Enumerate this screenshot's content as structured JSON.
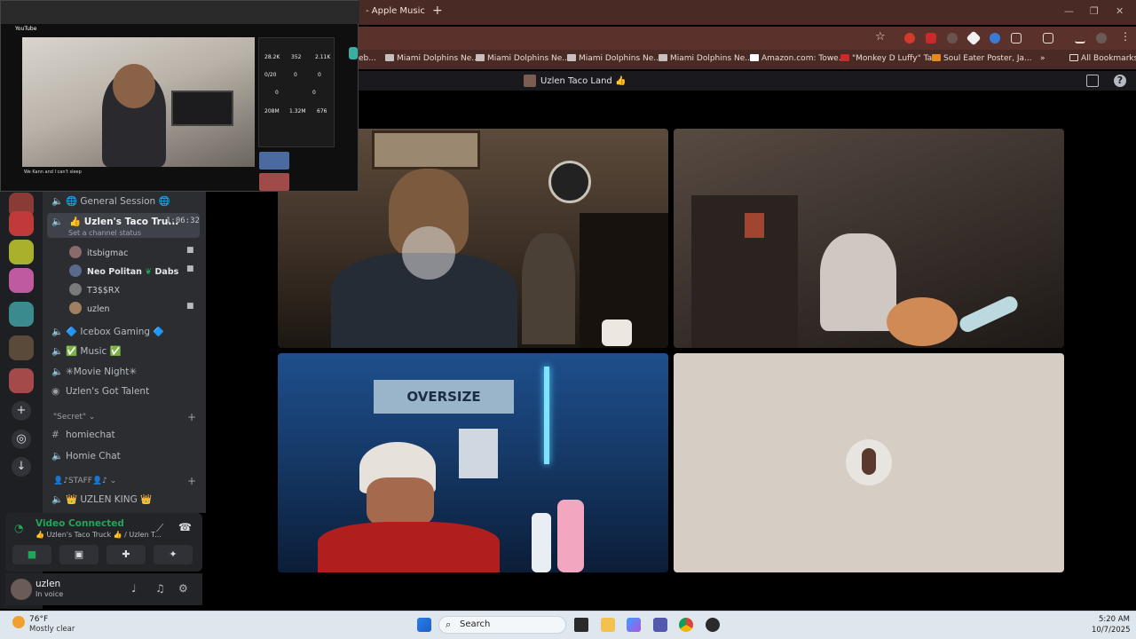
{
  "browser": {
    "tab_title": "- Apple Music",
    "bookmarks": [
      "eb...",
      "Miami Dolphins Ne...",
      "Miami Dolphins Ne...",
      "Miami Dolphins Ne...",
      "Miami Dolphins Ne...",
      "Amazon.com: Towe...",
      "\"Monkey D Luffy\" Ta...",
      "Soul Eater Poster, Ja..."
    ],
    "all_bookmarks": "All Bookmarks"
  },
  "discord": {
    "server_title": "Uzlen Taco Land 👍",
    "channels": {
      "general": "🌐 General Session 🌐",
      "active": "👍 Uzlen's Taco Tru...",
      "active_time": "1:06:32",
      "active_status": "Set a channel status",
      "members": [
        {
          "name": "itsbigmac",
          "badge": ""
        },
        {
          "name": "Neo Politan",
          "badge": "Dabs"
        },
        {
          "name": "T3$$RX",
          "badge": ""
        },
        {
          "name": "uzlen",
          "badge": ""
        }
      ],
      "icebox": "🔷 Icebox Gaming 🔷",
      "music": "✅ Music ✅",
      "movie": "✳Movie Night✳",
      "talent": "Uzlen's Got Talent",
      "secret_category": "\"Secret\"",
      "homiechat": "homiechat",
      "homie_chat": "Homie Chat",
      "staff_category": "👤♪STAFF👤♪",
      "uzlen_king": "👑 UZLEN KING 👑"
    },
    "voice": {
      "title": "Video Connected",
      "subtitle": "👍 Uzlen's Taco Truck 👍 / Uzlen T..."
    },
    "user": {
      "name": "uzlen",
      "status": "In voice"
    }
  },
  "pip": {
    "site": "YouTube",
    "stats": [
      "28.2K",
      "352",
      "2.11K",
      "0/20",
      "0",
      "0",
      "0",
      "0",
      "208M",
      "1.32M",
      "676"
    ],
    "caption": "We Kann and I can't sleep"
  },
  "taskbar": {
    "temp": "76°F",
    "weather": "Mostly clear",
    "search": "Search",
    "time": "5:20 AM",
    "date": "10/7/2025"
  }
}
